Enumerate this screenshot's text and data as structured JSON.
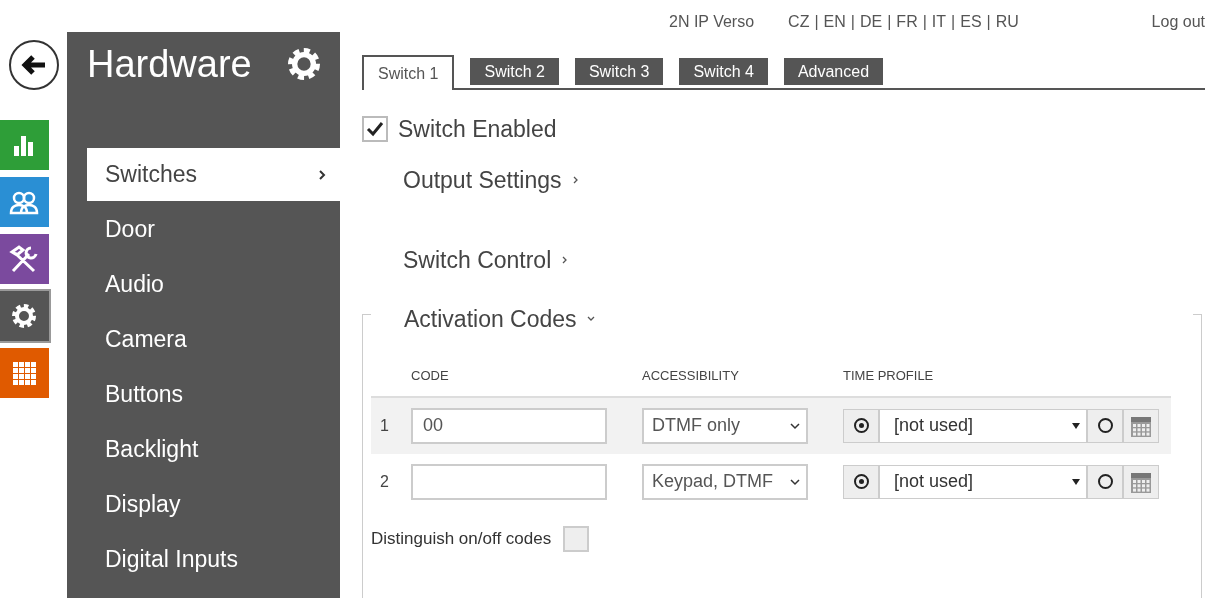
{
  "header": {
    "device": "2N IP Verso",
    "languages": [
      "CZ",
      "EN",
      "DE",
      "FR",
      "IT",
      "ES",
      "RU"
    ],
    "separator": "|",
    "logout": "Log out"
  },
  "app_bar": [
    {
      "kind": "chart",
      "color": "#2e9e38",
      "selected": false
    },
    {
      "kind": "users",
      "color": "#2a8fd4",
      "selected": false
    },
    {
      "kind": "tools",
      "color": "#7b4a9e",
      "selected": false
    },
    {
      "kind": "gear",
      "color": "#555555",
      "selected": true
    },
    {
      "kind": "grid",
      "color": "#e05a00",
      "selected": false
    }
  ],
  "sidebar": {
    "title": "Hardware",
    "items": [
      {
        "label": "Switches",
        "selected": true
      },
      {
        "label": "Door",
        "selected": false
      },
      {
        "label": "Audio",
        "selected": false
      },
      {
        "label": "Camera",
        "selected": false
      },
      {
        "label": "Buttons",
        "selected": false
      },
      {
        "label": "Backlight",
        "selected": false
      },
      {
        "label": "Display",
        "selected": false
      },
      {
        "label": "Digital Inputs",
        "selected": false
      }
    ]
  },
  "tabs": [
    {
      "label": "Switch 1",
      "selected": true
    },
    {
      "label": "Switch 2",
      "selected": false
    },
    {
      "label": "Switch 3",
      "selected": false
    },
    {
      "label": "Switch 4",
      "selected": false
    },
    {
      "label": "Advanced",
      "selected": false
    }
  ],
  "switch_enabled": {
    "label": "Switch Enabled",
    "checked": true
  },
  "sections": [
    {
      "title": "Output Settings",
      "expanded": false
    },
    {
      "title": "Switch Control",
      "expanded": false
    }
  ],
  "activation_codes": {
    "title": "Activation Codes",
    "expanded": true,
    "columns": [
      "CODE",
      "ACCESSIBILITY",
      "TIME PROFILE"
    ],
    "rows": [
      {
        "index": "1",
        "code": "00",
        "accessibility": "DTMF only",
        "time_profile": "[not used]",
        "profile_selected": true,
        "highlighted": true
      },
      {
        "index": "2",
        "code": "",
        "accessibility": "Keypad, DTMF",
        "time_profile": "[not used]",
        "profile_selected": true,
        "highlighted": false
      }
    ],
    "distinguish": {
      "label": "Distinguish on/off codes",
      "checked": false
    }
  }
}
